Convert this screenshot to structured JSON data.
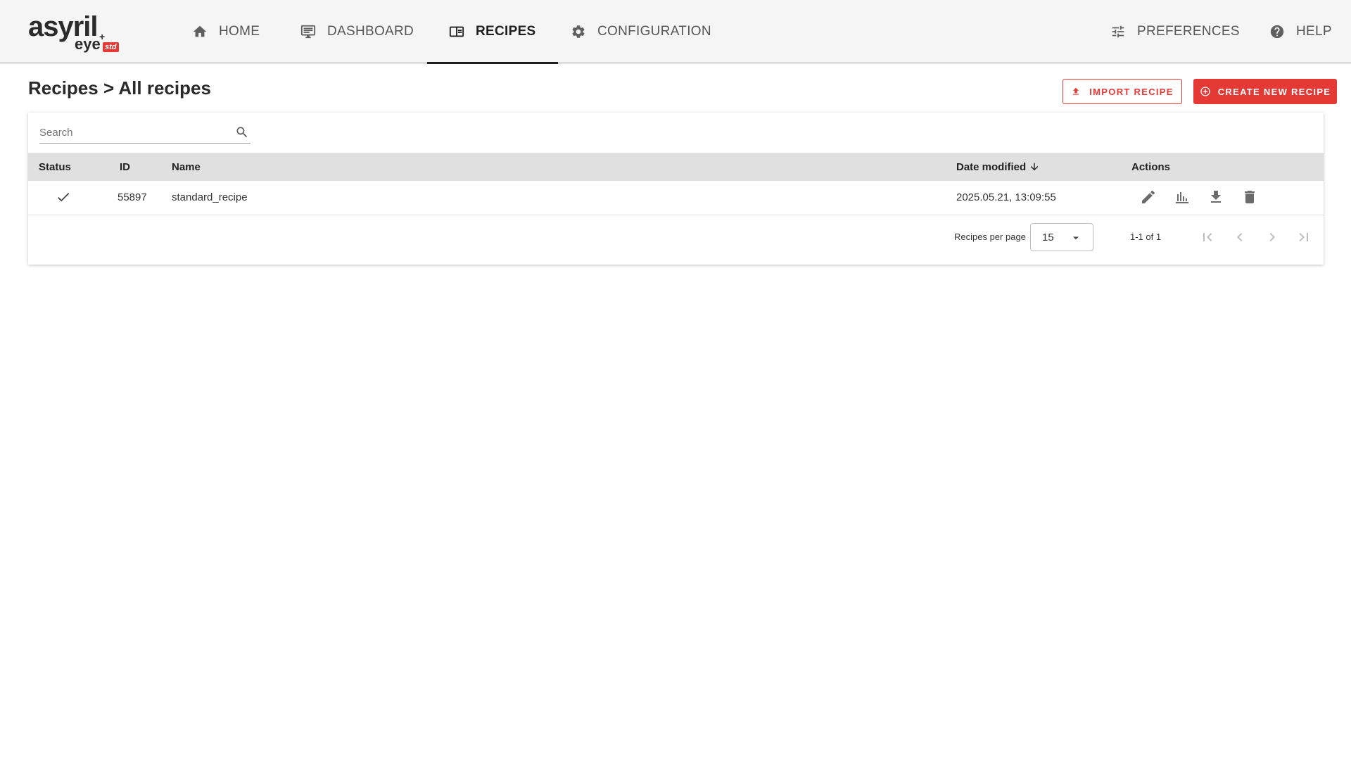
{
  "brand": {
    "name": "asyril",
    "product": "eye",
    "plus": "+",
    "edition": "std"
  },
  "nav": {
    "home": "HOME",
    "dashboard": "DASHBOARD",
    "recipes": "RECIPES",
    "configuration": "CONFIGURATION",
    "preferences": "PREFERENCES",
    "help": "HELP",
    "active": "recipes"
  },
  "page": {
    "title": "Recipes > All recipes",
    "import_label": "IMPORT RECIPE",
    "create_label": "CREATE NEW RECIPE"
  },
  "search": {
    "placeholder": "Search",
    "value": ""
  },
  "table": {
    "columns": {
      "status": "Status",
      "id": "ID",
      "name": "Name",
      "date_modified": "Date modified",
      "actions": "Actions"
    },
    "sort": {
      "column": "date_modified",
      "direction": "descending",
      "icon": "arrow-down-icon"
    },
    "rows": [
      {
        "status_icon": "check-icon",
        "id": "55897",
        "name": "standard_recipe",
        "date_modified": "2025.05.21, 13:09:55",
        "actions": [
          "edit-icon",
          "bar-chart-icon",
          "download-icon",
          "delete-icon"
        ]
      }
    ]
  },
  "pagination": {
    "per_page_label": "Recipes per page",
    "per_page_value": "15",
    "range": "1-1 of 1"
  },
  "colors": {
    "accent": "#e53935",
    "topbar": "#f5f5f5",
    "table_header": "#e0e0e0"
  }
}
